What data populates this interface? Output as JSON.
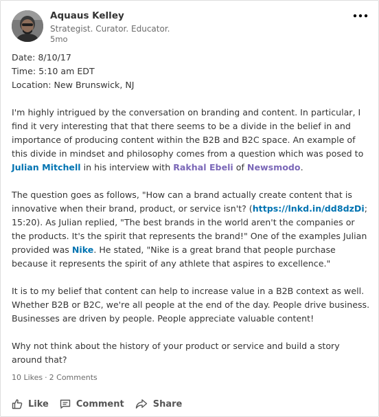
{
  "post": {
    "author": {
      "name": "Aquaus Kelley",
      "headline": "Strategist. Curator. Educator.",
      "age": "5mo"
    },
    "meta": {
      "date": "Date: 8/10/17",
      "time": "Time: 5:10 am EDT",
      "location": "Location: New Brunswick, NJ"
    },
    "p1": {
      "text": "I'm highly intrigued by the conversation on branding and content. In particular, I find it very interesting that that there seems to be a divide in the belief in and importance of producing content within the B2B and B2C space. An example of this divide in mindset and philosophy comes from a question which was posed to ",
      "mention1": "Julian Mitchell",
      "t2": " in his interview with ",
      "mention2": "Rakhal Ebeli",
      "t3": " of ",
      "mention3": "Newsmodo",
      "t4": "."
    },
    "p2": {
      "text": "The question goes as follows, \"How can a brand actually create content that is innovative when their brand, product, or service isn't? (",
      "link": "https://lnkd.in/dd8dzDi",
      "t2": "; 15:20). As Julian replied, \"The best brands in the world aren't the companies or the products. It's the spirit that represents the brand!\" One of the examples Julian provided was ",
      "mention": "Nike",
      "t3": ". He stated, \"Nike is a great brand that people purchase because it represents the spirit of any athlete that aspires to excellence.\""
    },
    "p3": "It is to my belief that content can help to increase value in a B2B context as well. Whether B2B or B2C, we're all people at the end of the day. People drive business. Businesses are driven by people. People appreciate valuable content!",
    "p4": "Why not think about the history of your product or service and build a story around that?"
  },
  "social": {
    "likes": "10 Likes",
    "separator": "·",
    "comments": "2 Comments"
  },
  "actions": {
    "like": "Like",
    "comment": "Comment",
    "share": "Share"
  },
  "icons": {
    "more": "more-horizontal-icon",
    "like": "thumbs-up-icon",
    "comment": "comment-icon",
    "share": "share-arrow-icon"
  },
  "colors": {
    "link": "#0073b1",
    "mention_secondary": "#7b68b8",
    "text": "#333333",
    "muted": "#6b6b6b"
  }
}
